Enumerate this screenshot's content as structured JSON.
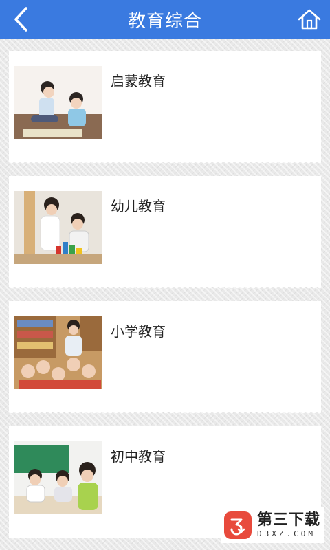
{
  "header": {
    "title": "教育综合",
    "back_icon": "chevron-left-icon",
    "home_icon": "home-icon"
  },
  "items": [
    {
      "label": "启蒙教育",
      "image": "teacher-and-child-puzzle-photo"
    },
    {
      "label": "幼儿教育",
      "image": "teacher-and-child-blocks-photo"
    },
    {
      "label": "小学教育",
      "image": "classroom-students-photo"
    },
    {
      "label": "初中教育",
      "image": "students-studying-photo"
    }
  ],
  "watermark": {
    "name": "第三下载",
    "domain": "D3XZ.COM"
  },
  "colors": {
    "header": "#3a7ae0",
    "logo": "#e84a3c"
  }
}
